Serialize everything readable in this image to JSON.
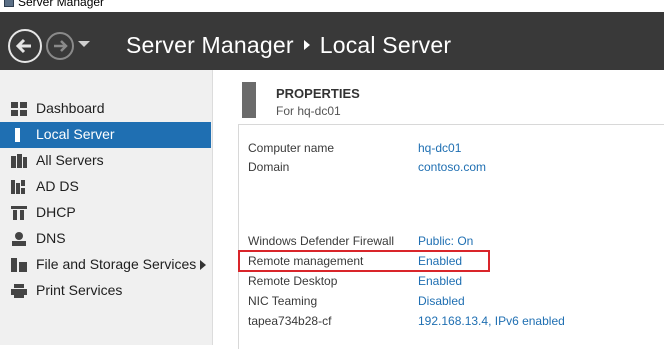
{
  "window": {
    "title": "Server Manager"
  },
  "header": {
    "back_icon": "back-arrow-icon",
    "forward_icon": "forward-arrow-icon",
    "breadcrumb": [
      "Server Manager",
      "Local Server"
    ]
  },
  "sidebar": {
    "items": [
      {
        "label": "Dashboard",
        "icon": "dashboard-icon",
        "selected": false
      },
      {
        "label": "Local Server",
        "icon": "local-server-icon",
        "selected": true
      },
      {
        "label": "All Servers",
        "icon": "all-servers-icon",
        "selected": false
      },
      {
        "label": "AD DS",
        "icon": "ad-ds-icon",
        "selected": false
      },
      {
        "label": "DHCP",
        "icon": "dhcp-icon",
        "selected": false
      },
      {
        "label": "DNS",
        "icon": "dns-icon",
        "selected": false
      },
      {
        "label": "File and Storage Services",
        "icon": "file-storage-icon",
        "selected": false,
        "expandable": true
      },
      {
        "label": "Print Services",
        "icon": "printer-icon",
        "selected": false
      }
    ]
  },
  "properties": {
    "title": "PROPERTIES",
    "subtitle": "For hq-dc01",
    "rows_top": [
      {
        "key": "Computer name",
        "value": "hq-dc01"
      },
      {
        "key": "Domain",
        "value": "contoso.com"
      }
    ],
    "rows_bottom": [
      {
        "key": "Windows Defender Firewall",
        "value": "Public: On"
      },
      {
        "key": "Remote management",
        "value": "Enabled"
      },
      {
        "key": "Remote Desktop",
        "value": "Enabled"
      },
      {
        "key": "NIC Teaming",
        "value": "Disabled"
      },
      {
        "key": "tapea734b28-cf",
        "value": "192.168.13.4, IPv6 enabled"
      }
    ]
  },
  "colors": {
    "header_bg": "#393939",
    "accent": "#1f6fb2",
    "highlight": "#d9252a"
  }
}
